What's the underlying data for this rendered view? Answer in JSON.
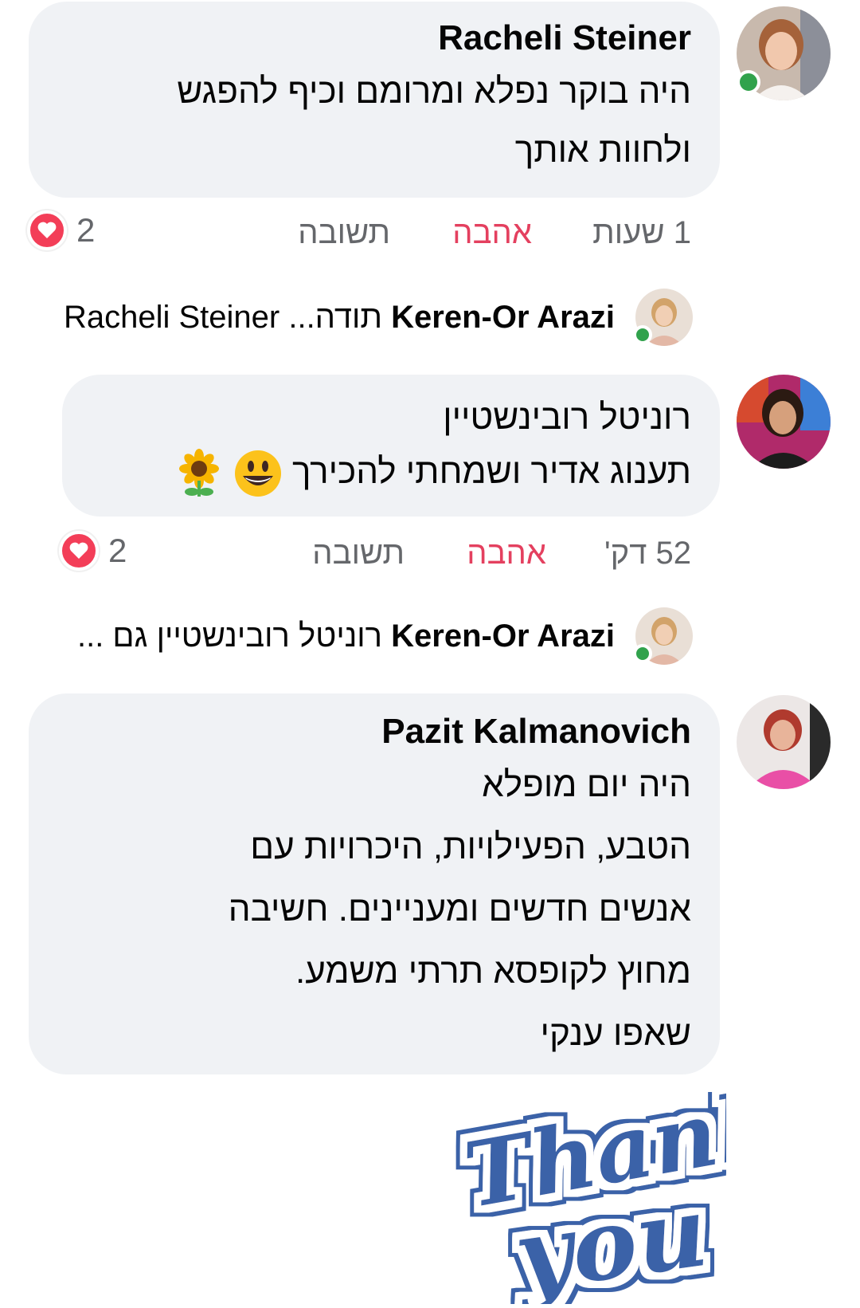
{
  "comments": [
    {
      "author": "Racheli Steiner",
      "lines": [
        "היה בוקר נפלא ומרומם וכיף להפגש",
        "ולחוות אותך"
      ],
      "time": "1 שעות",
      "love_label": "אהבה",
      "reply_label": "תשובה",
      "reaction_count": "2",
      "reply": {
        "author": "Keren-Or Arazi",
        "text": "תודה...",
        "mention": "Racheli Steiner"
      }
    },
    {
      "author": "רוניטל רובינשטיין",
      "lines": [
        "תענוג אדיר ושמחתי להכירך"
      ],
      "emojis": [
        "grinning-face-emoji",
        "sunflower-emoji"
      ],
      "time": "52 דק'",
      "love_label": "אהבה",
      "reply_label": "תשובה",
      "reaction_count": "2",
      "reply": {
        "author": "Keren-Or Arazi",
        "text": "רוניטל רובינשטיין גם ..."
      }
    },
    {
      "author": "Pazit Kalmanovich",
      "lines": [
        "היה יום מופלא",
        "הטבע, הפעילויות, היכרויות עם",
        "אנשים חדשים ומעניינים. חשיבה",
        "מחוץ לקופסא תרתי משמע.",
        "שאפו ענקי"
      ]
    }
  ],
  "sticker": {
    "line1": "Thank",
    "line2": "you",
    "color": "#3b62a8"
  },
  "colors": {
    "bubble": "#f0f2f5",
    "meta": "#65676b",
    "love": "#e4405f",
    "online": "#31a24c",
    "heart": "#f33e58"
  }
}
